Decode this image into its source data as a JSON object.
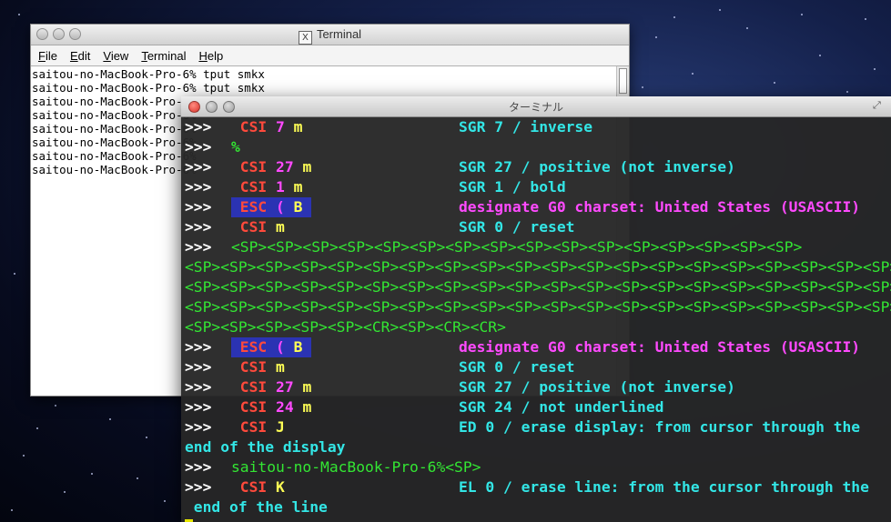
{
  "xterm": {
    "title": "Terminal",
    "menu": [
      "File",
      "Edit",
      "View",
      "Terminal",
      "Help"
    ],
    "lines": [
      "saitou-no-MacBook-Pro-6% tput smkx",
      "saitou-no-MacBook-Pro-6% tput smkx",
      "saitou-no-MacBook-Pro-6%",
      "saitou-no-MacBook-Pro-6%",
      "saitou-no-MacBook-Pro-6%",
      "saitou-no-MacBook-Pro-6%",
      "saitou-no-MacBook-Pro-6%",
      "saitou-no-MacBook-Pro-6%"
    ]
  },
  "mac": {
    "title": "ターミナル",
    "prompt": ">>>",
    "rows": [
      {
        "seq": "CSI",
        "num": "7",
        "fin": "m",
        "desc": "SGR 7 / inverse"
      },
      {
        "pct": "%"
      },
      {
        "seq": "CSI",
        "num": "27",
        "fin": "m",
        "desc": "SGR 27 / positive (not inverse)"
      },
      {
        "seq": "CSI",
        "num": "1",
        "fin": "m",
        "desc": "SGR 1 / bold"
      },
      {
        "seq": "ESC",
        "num": "(",
        "fin": "B",
        "desc": "designate G0 charset: United States (USASCII)",
        "hl": true
      },
      {
        "seq": "CSI",
        "num": "",
        "fin": "m",
        "desc": "SGR 0 / reset"
      },
      {
        "sp": "<SP><SP><SP><SP><SP><SP><SP><SP><SP><SP><SP><SP><SP><SP><SP><SP>"
      },
      {
        "cont": "<SP><SP><SP><SP><SP><SP><SP><SP><SP><SP><SP><SP><SP><SP><SP><SP><SP><SP><SP><SP><SP><SP><SP><SP><SP><SP><SP><SP><SP><SP><SP><SP><SP><SP><SP><SP><SP><SP><SP><SP><SP><SP><SP><SP><SP><SP><SP><SP><SP><SP><SP><SP><SP><SP><SP><SP><SP><SP><SP><SP><SP><SP><SP><SP><SP><SP><SP><SP><SP><SP><SP><SP><SP><SP><SP><SP><SP><SP><SP><SP><SP><SP><SP><SP><SP><SP><SP><SP><SP><SP><SP><SP><SP><SP><SP><SP><SP><SP><SP><SP><SP><SP><SP><SP><SP><SP><SP><SP><SP><SP><SP><SP><SP><SP><SP><SP><SP><SP><SP><SP><SP><SP><SP><SP><SP><SP><SP><SP><SP><SP><SP><SP><SP><SP><SP><SP><SP><SP><SP><SP><SP><SP><SP><SP><SP><SP><SP><SP><SP><SP><SP><SP><SP><SP><SP><SP><SP><SP><SP><SP><SP><SP><SP><SP><SP><SP><SP><SP><SP><SP><SP><SP><SP><SP><SP><SP><SP><SP><SP><SP><SP><SP><SP><SP><SP><SP><SP><SP><SP><SP><SP><SP><SP><SP><SP><SP><SP><SP><SP><SP><SP><SP><SP><SP><SP><SP><SP><SP><SP><SP><SP><SP><SP><SP><SP><SP><SP><SP><SP><SP><SP><SP><SP><SP><SP><SP><SP><SP><SP><SP><SP><SP><SP><SP><SP><SP><SP><SP><SP><SP><SP><SP><SP><SP><SP><SP><SP><SP><SP><SP><SP><SP><SP><SP><SP><SP><SP><SP><SP><SP><SP><SP><SP><SP><SP><SP><SP><SP><SP><SP><SP><SP><SP><SP><SP><SP><SP><SP><SP><SP><SP><SP><SP><SP><SP><SP><SP><SP><SP><SP><SP><SP><SP><SP><SP><SP>"
      },
      {
        "cont": "<SP><SP><SP><SP><SP><SP><SP><SP><SP><SP><SP><SP><SP><SP><SP><SP><SP><SP><SP><SP>"
      },
      {
        "cont": "<SP><SP><SP><SP><SP><SP><SP><SP><SP><SP><SP><SP><SP><SP><SP><SP><SP><SP><SP><SP>"
      },
      {
        "cont": "<SP><SP><SP><SP><SP><CR><SP><CR><CR>"
      },
      {
        "seq": "ESC",
        "num": "(",
        "fin": "B",
        "desc": "designate G0 charset: United States (USASCII)",
        "hl": true
      },
      {
        "seq": "CSI",
        "num": "",
        "fin": "m",
        "desc": "SGR 0 / reset"
      },
      {
        "seq": "CSI",
        "num": "27",
        "fin": "m",
        "desc": "SGR 27 / positive (not inverse)"
      },
      {
        "seq": "CSI",
        "num": "24",
        "fin": "m",
        "desc": "SGR 24 / not underlined"
      },
      {
        "seq": "CSI",
        "num": "",
        "fin": "J",
        "desc": "ED 0 / erase display: from cursor through the"
      },
      {
        "contc": "end of the display"
      },
      {
        "host": "saitou-no-MacBook-Pro-6%<SP>"
      },
      {
        "seq": "CSI",
        "num": "",
        "fin": "K",
        "desc": "EL 0 / erase line: from the cursor through the"
      },
      {
        "contc": " end of the line"
      }
    ]
  }
}
